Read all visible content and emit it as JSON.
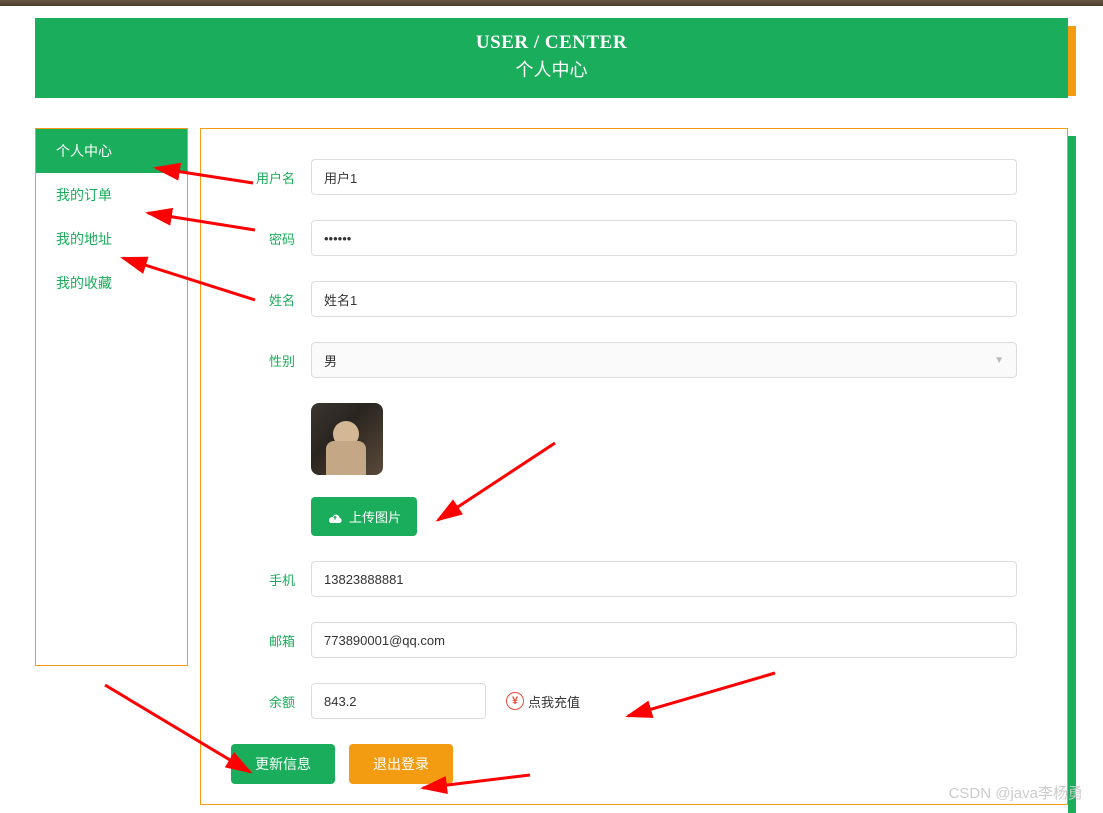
{
  "banner": {
    "title_en": "USER / CENTER",
    "title_cn": "个人中心"
  },
  "sidebar": {
    "items": [
      {
        "label": "个人中心",
        "active": true
      },
      {
        "label": "我的订单",
        "active": false
      },
      {
        "label": "我的地址",
        "active": false
      },
      {
        "label": "我的收藏",
        "active": false
      }
    ]
  },
  "form": {
    "username_label": "用户名",
    "username_value": "用户1",
    "password_label": "密码",
    "password_value": "••••••",
    "name_label": "姓名",
    "name_value": "姓名1",
    "gender_label": "性别",
    "gender_value": "男",
    "upload_label": "上传图片",
    "phone_label": "手机",
    "phone_value": "13823888881",
    "email_label": "邮箱",
    "email_value": "773890001@qq.com",
    "balance_label": "余额",
    "balance_value": "843.2",
    "recharge_label": "点我充值",
    "yen_symbol": "¥"
  },
  "buttons": {
    "update_label": "更新信息",
    "logout_label": "退出登录"
  },
  "watermark": "CSDN @java李杨勇"
}
